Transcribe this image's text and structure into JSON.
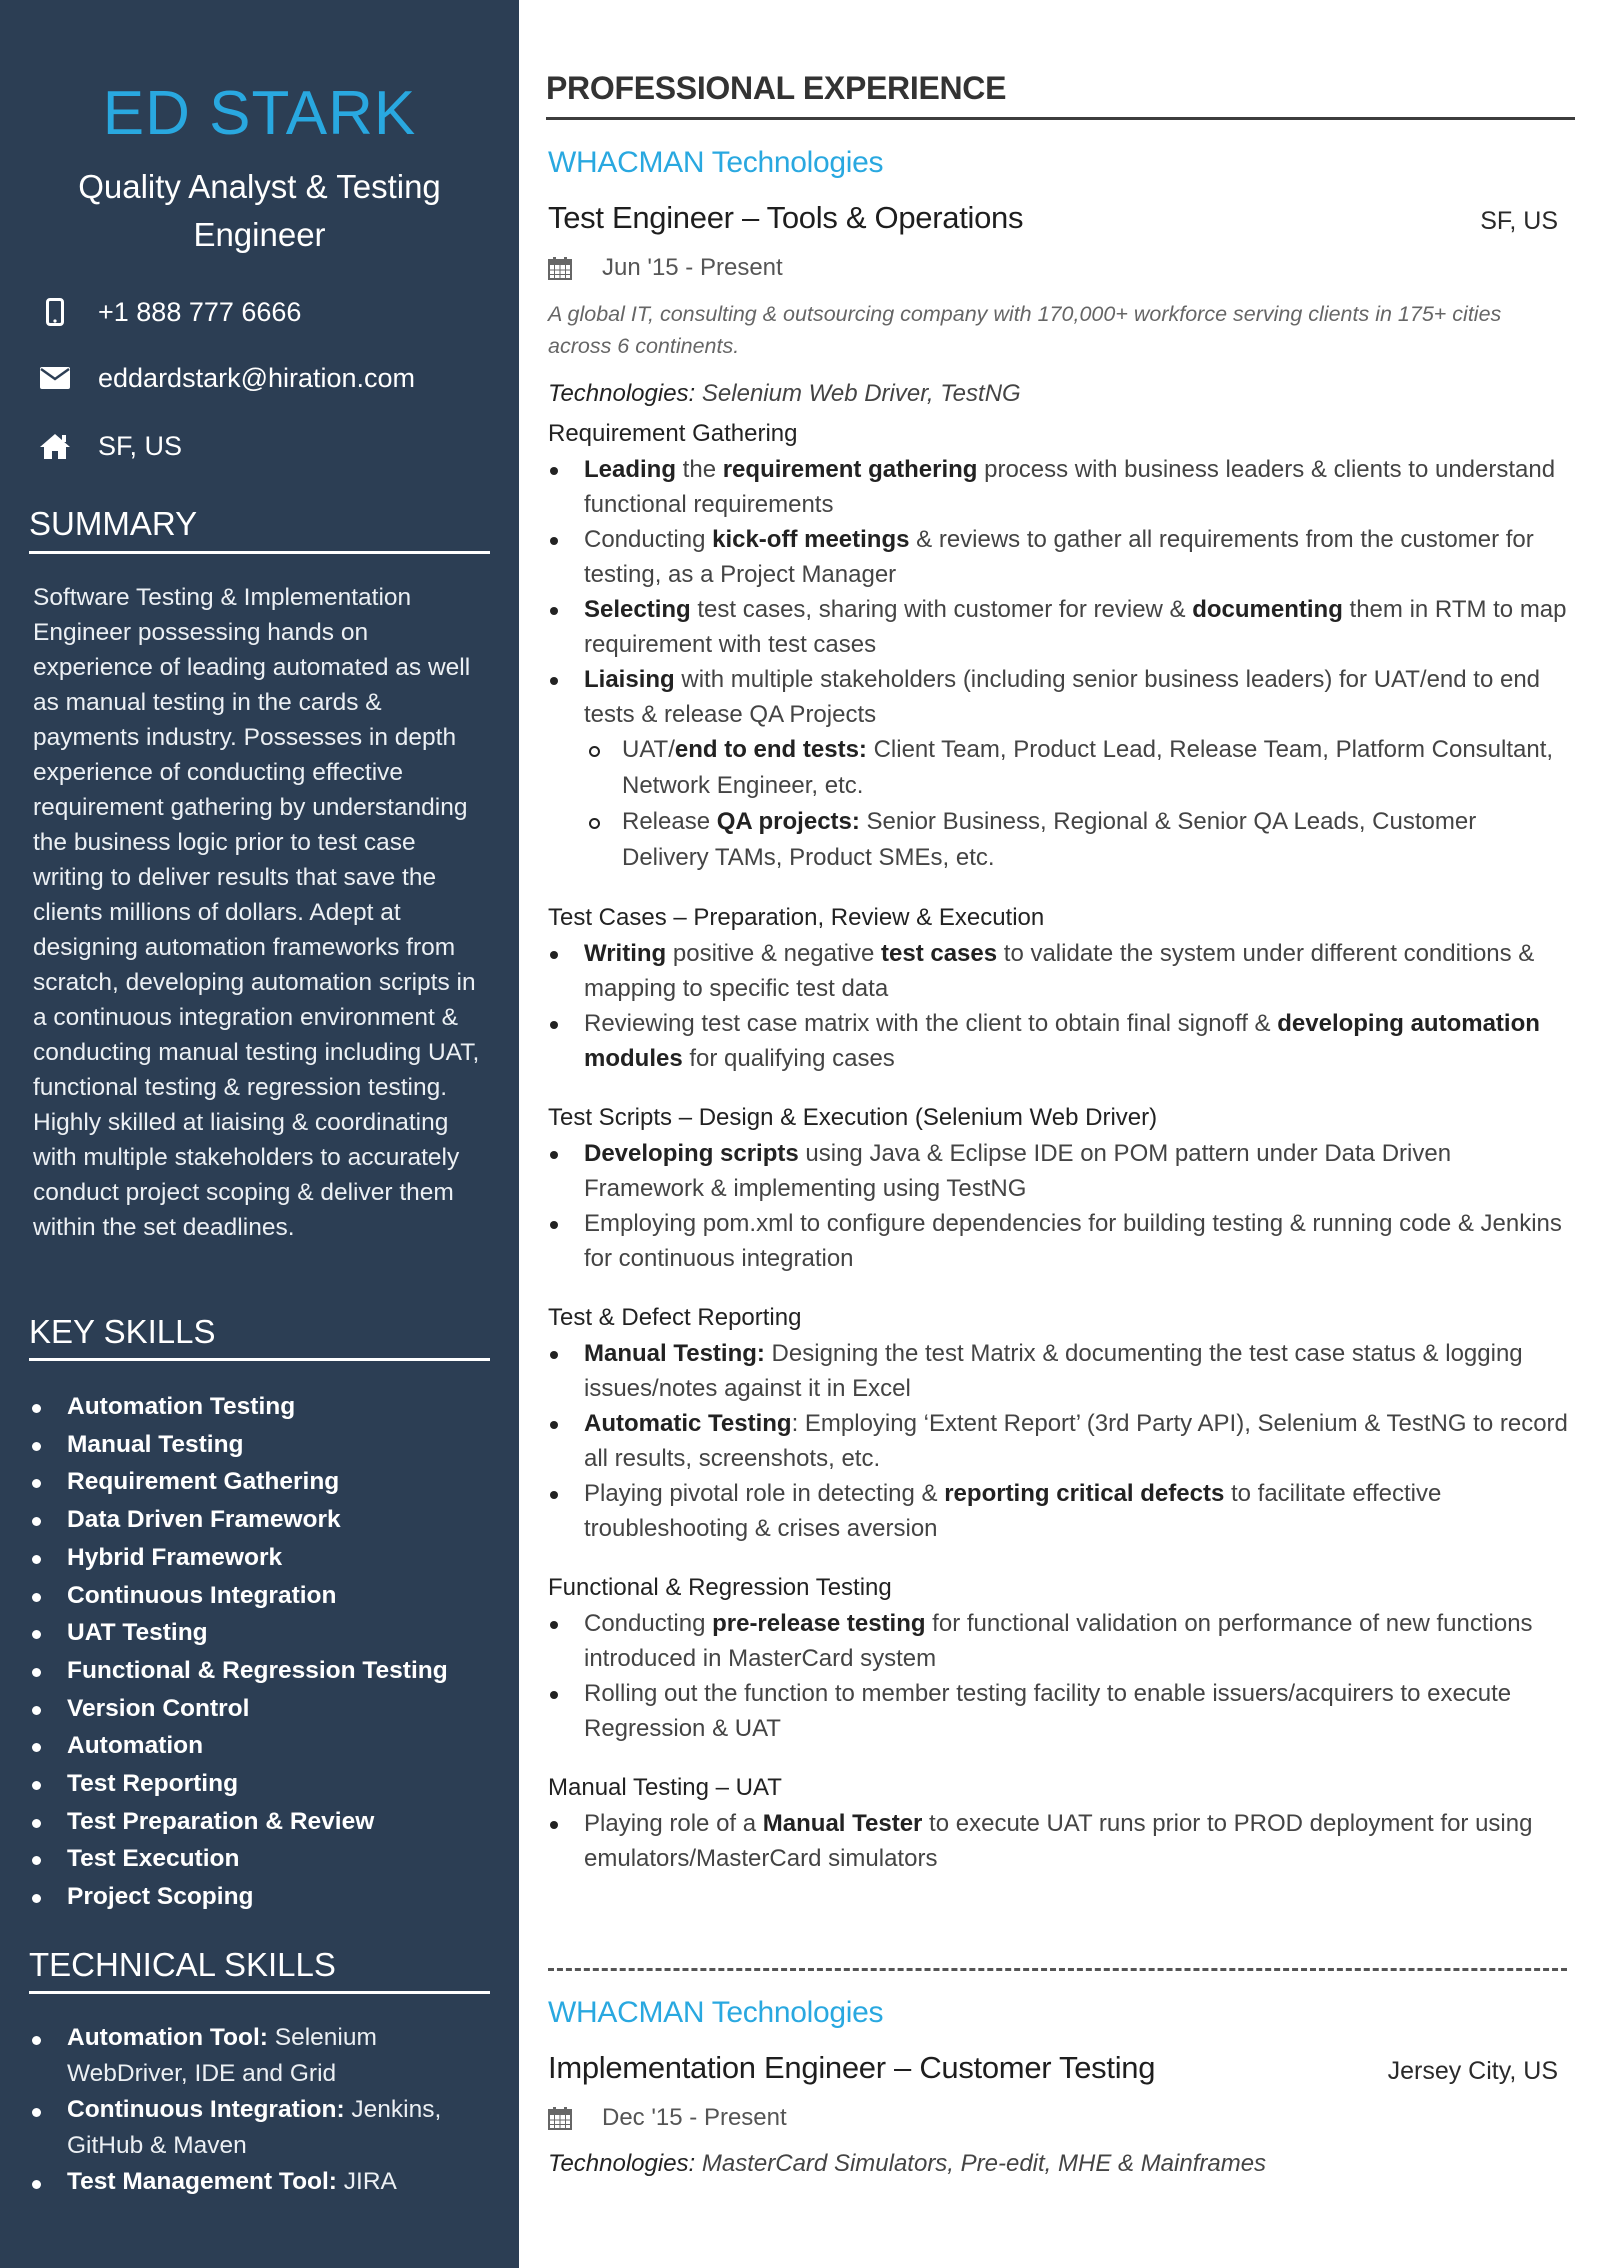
{
  "sidebar": {
    "name": "ED STARK",
    "role": "Quality Analyst & Testing Engineer",
    "contact": {
      "phone": "+1 888 777 6666",
      "email": "eddardstark@hiration.com",
      "location": "SF, US"
    },
    "icons": {
      "phone": "phone-icon",
      "email": "envelope-icon",
      "location": "home-icon"
    },
    "summary_heading": "SUMMARY",
    "summary": "Software Testing & Implementation Engineer possessing hands on experience of leading automated as well as manual testing in the cards & payments industry. Possesses in depth experience of conducting effective requirement gathering by understanding the business logic prior to test case writing to deliver results that save the clients millions of dollars. Adept at designing automation frameworks from scratch, developing automation scripts in a continuous integration environment & conducting manual testing including UAT, functional testing & regression testing. Highly skilled at liaising & coordinating with multiple stakeholders to accurately conduct project scoping & deliver them within the set deadlines.",
    "key_skills_heading": "KEY SKILLS",
    "key_skills": [
      "Automation Testing",
      "Manual Testing",
      "Requirement Gathering",
      "Data Driven Framework",
      "Hybrid Framework",
      "Continuous Integration",
      "UAT Testing",
      "Functional & Regression Testing",
      "Version Control",
      "Automation",
      "Test Reporting",
      "Test Preparation & Review",
      "Test Execution",
      "Project Scoping"
    ],
    "technical_skills_heading": "TECHNICAL SKILLS",
    "technical_skills": [
      {
        "label": "Automation Tool:",
        "value": " Selenium WebDriver, IDE and Grid"
      },
      {
        "label": "Continuous Integration:",
        "value": " Jenkins, GitHub & Maven"
      },
      {
        "label": "Test Management Tool:",
        "value": " JIRA"
      }
    ]
  },
  "main": {
    "section_title": "PROFESSIONAL EXPERIENCE",
    "jobs": [
      {
        "company": "WHACMAN Technologies",
        "title": "Test Engineer – Tools & Operations",
        "location": "SF, US",
        "dates": "Jun '15 -  Present",
        "description": "A global IT, consulting & outsourcing company with 170,000+ workforce serving clients in 175+ cities across 6 continents.",
        "technologies_label": "Technologies:",
        "technologies": " Selenium Web Driver, TestNG",
        "groups": [
          {
            "heading": "Requirement Gathering",
            "bullets": [
              [
                {
                  "b": "Leading"
                },
                {
                  "t": " the "
                },
                {
                  "b": "requirement gathering"
                },
                {
                  "t": " process with business leaders & clients to understand functional requirements"
                }
              ],
              [
                {
                  "t": "Conducting "
                },
                {
                  "b": "kick-off meetings"
                },
                {
                  "t": " & reviews to gather all requirements from the customer for testing, as a Project Manager"
                }
              ],
              [
                {
                  "b": "Selecting"
                },
                {
                  "t": " test cases, sharing with customer for review & "
                },
                {
                  "b": "documenting"
                },
                {
                  "t": " them in RTM to map requirement with test cases"
                }
              ],
              [
                {
                  "b": "Liaising"
                },
                {
                  "t": " with multiple stakeholders (including senior business leaders) for UAT/end to end tests & release QA Projects"
                }
              ]
            ],
            "sub_bullets": [
              [
                {
                  "t": "UAT/"
                },
                {
                  "b": "end to end tests:"
                },
                {
                  "t": " Client Team, Product Lead, Release Team, Platform Consultant, Network Engineer, etc."
                }
              ],
              [
                {
                  "t": "Release "
                },
                {
                  "b": "QA projects:"
                },
                {
                  "t": " Senior Business, Regional & Senior QA Leads, Customer Delivery TAMs, Product SMEs, etc."
                }
              ]
            ]
          },
          {
            "heading": "Test Cases – Preparation, Review & Execution",
            "bullets": [
              [
                {
                  "b": "Writing"
                },
                {
                  "t": " positive & negative "
                },
                {
                  "b": "test cases"
                },
                {
                  "t": " to validate the system under different conditions & mapping to specific test data"
                }
              ],
              [
                {
                  "t": "Reviewing test case matrix with the client to obtain final signoff & "
                },
                {
                  "b": "developing automation modules"
                },
                {
                  "t": " for qualifying cases"
                }
              ]
            ]
          },
          {
            "heading": "Test Scripts – Design & Execution (Selenium Web Driver)",
            "bullets": [
              [
                {
                  "b": "Developing scripts"
                },
                {
                  "t": " using Java & Eclipse IDE on POM pattern under Data Driven Framework & implementing using TestNG"
                }
              ],
              [
                {
                  "t": "Employing pom.xml to configure dependencies for building testing & running code & Jenkins for continuous integration"
                }
              ]
            ]
          },
          {
            "heading": "Test & Defect Reporting",
            "bullets": [
              [
                {
                  "b": "Manual Testing:"
                },
                {
                  "t": "  Designing the test Matrix & documenting the test case status & logging issues/notes against it in Excel"
                }
              ],
              [
                {
                  "b": "Automatic Testing"
                },
                {
                  "t": ": Employing ‘Extent Report’ (3rd Party API), Selenium & TestNG to record all results, screenshots, etc."
                }
              ],
              [
                {
                  "t": "Playing pivotal role in detecting & "
                },
                {
                  "b": "reporting critical defects"
                },
                {
                  "t": " to facilitate effective troubleshooting & crises aversion"
                }
              ]
            ]
          },
          {
            "heading": "Functional & Regression Testing",
            "bullets": [
              [
                {
                  "t": "Conducting "
                },
                {
                  "b": "pre-release testing"
                },
                {
                  "t": " for functional validation on performance of new functions introduced in MasterCard system"
                }
              ],
              [
                {
                  "t": "Rolling out the function to member testing facility to enable issuers/acquirers to execute Regression & UAT"
                }
              ]
            ]
          },
          {
            "heading": "Manual Testing – UAT",
            "bullets": [
              [
                {
                  "t": "Playing role of a "
                },
                {
                  "b": "Manual Tester"
                },
                {
                  "t": " to execute UAT runs prior to PROD deployment for using emulators/MasterCard simulators"
                }
              ]
            ]
          }
        ]
      },
      {
        "company": "WHACMAN Technologies",
        "title": "Implementation Engineer – Customer Testing",
        "location": "Jersey City, US",
        "dates": "Dec '15 -  Present",
        "technologies_label": "Technologies:",
        "technologies": " MasterCard Simulators, Pre-edit, MHE & Mainframes"
      }
    ]
  },
  "colors": {
    "sidebar_bg": "#2c3e54",
    "accent": "#29a8e0",
    "text_dark": "#222222"
  }
}
